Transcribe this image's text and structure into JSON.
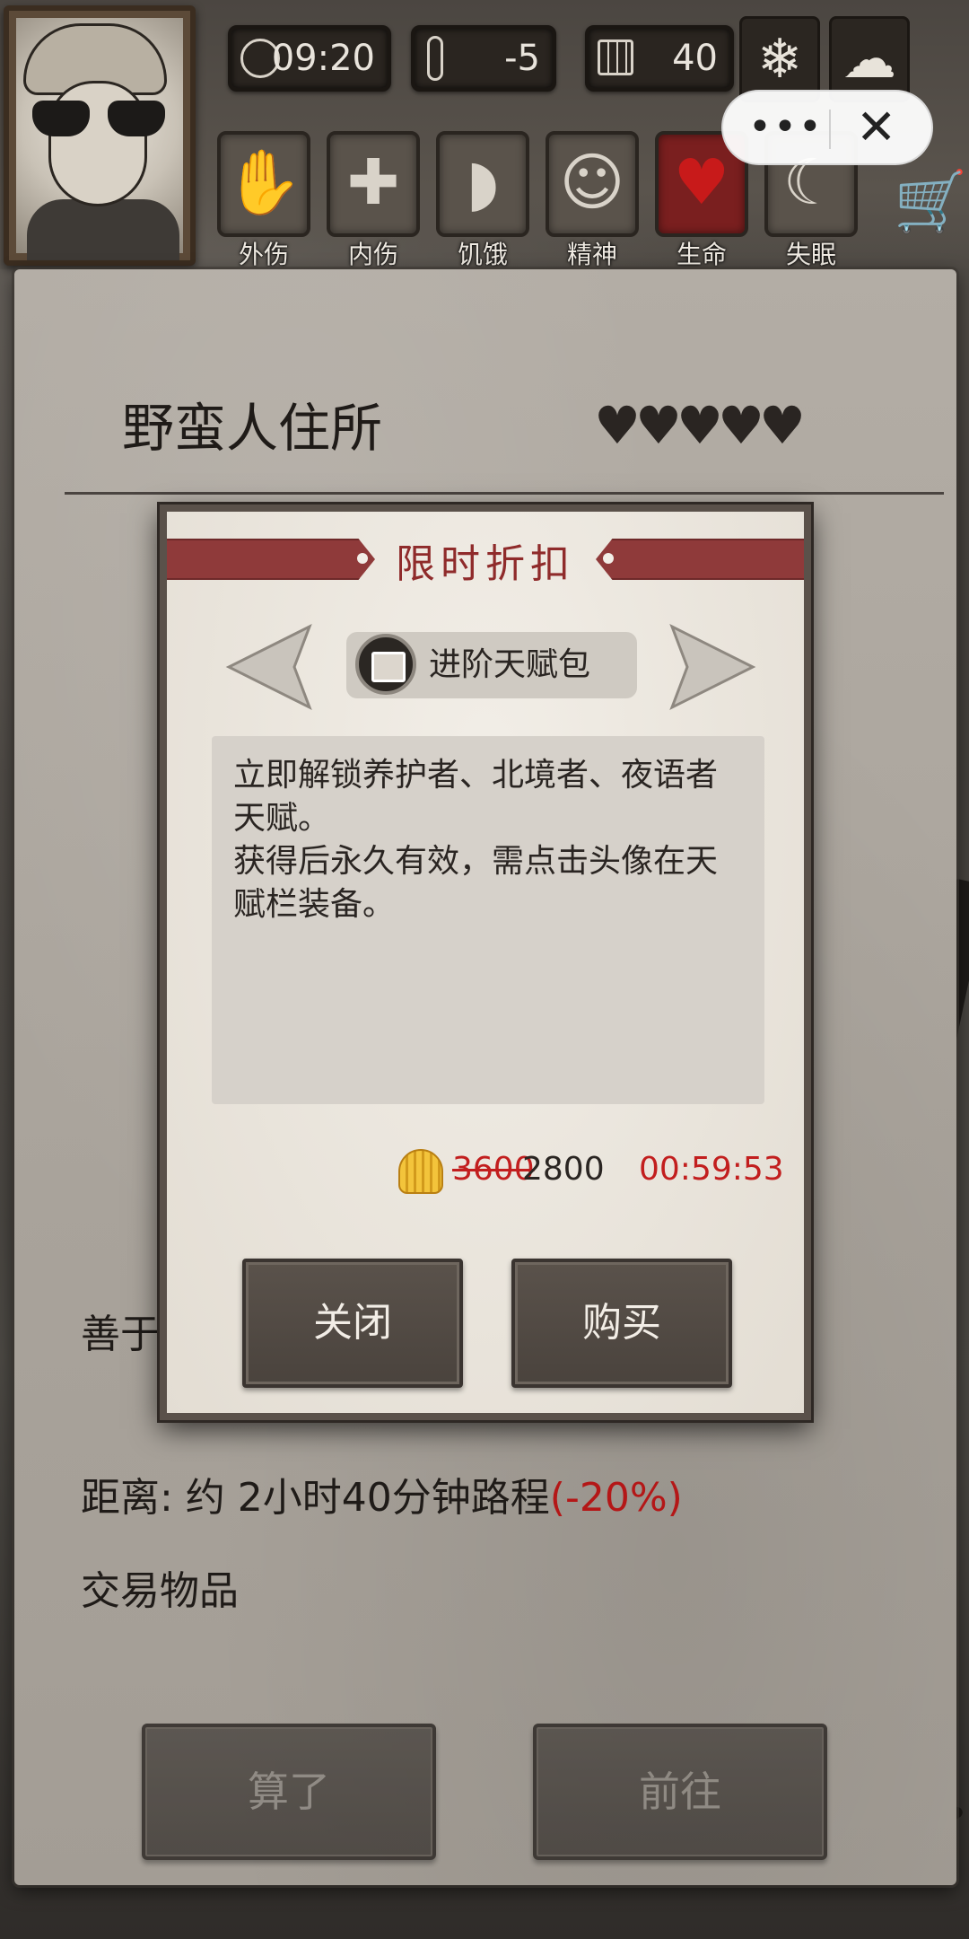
{
  "hud": {
    "time": "09:20",
    "temperature": "-5",
    "day": "40",
    "weather_icons": [
      "snowflake-icon",
      "cloud-icon"
    ],
    "status": [
      {
        "label": "外伤",
        "icon": "hand-bandage-icon",
        "active": false
      },
      {
        "label": "内伤",
        "icon": "cross-icon",
        "active": false
      },
      {
        "label": "饥饿",
        "icon": "stomach-icon",
        "active": false
      },
      {
        "label": "精神",
        "icon": "head-sparkle-icon",
        "active": false
      },
      {
        "label": "生命",
        "icon": "heart-icon",
        "active": true
      },
      {
        "label": "失眠",
        "icon": "moon-icon",
        "active": false
      }
    ]
  },
  "mini_program": {
    "menu": "•••",
    "close": "✕"
  },
  "location": {
    "title": "野蛮人住所",
    "hearts": "♥♥♥♥♥",
    "side_text": "善于",
    "distance_prefix": "距离: 约 2小时40分钟路程",
    "distance_penalty": "(-20%)",
    "trade_label": "交易物品",
    "cancel_button": "算了",
    "go_button": "前往"
  },
  "dialog": {
    "title": "限时折扣",
    "pack_name": "进阶天赋包",
    "description": "立即解锁养护者、北境者、夜语者天赋。\n获得后永久有效，需点击头像在天赋栏装备。",
    "old_price": "3600",
    "new_price": "2800",
    "timer": "00:59:53",
    "close_button": "关闭",
    "buy_button": "购买"
  },
  "colors": {
    "accent_red": "#c21e1e",
    "ribbon": "#8f3a3a",
    "parchment": "#e9e4db"
  }
}
